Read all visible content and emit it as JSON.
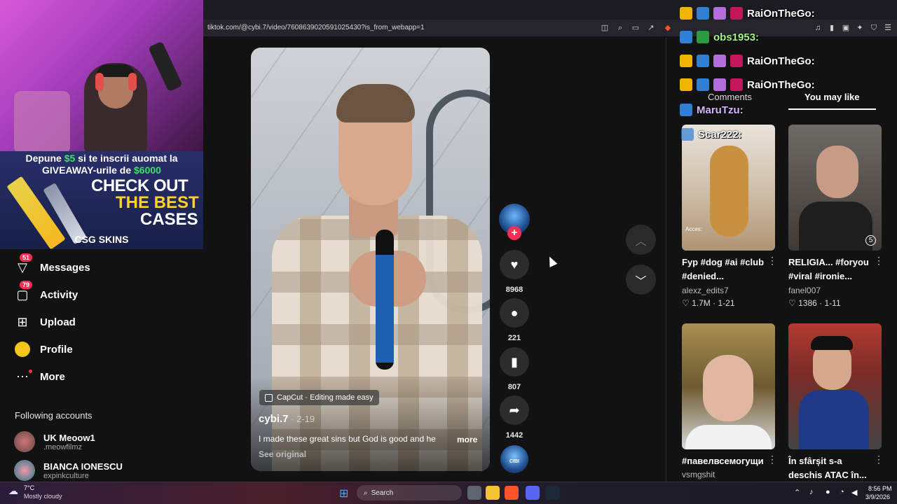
{
  "browser": {
    "url": "tiktok.com/@cybi.7/video/7608639020591025430?is_from_webapp=1"
  },
  "stream_overlay": {
    "promo_line_1_a": "Depune ",
    "promo_line_1_b": "$5",
    "promo_line_1_c": " si te inscrii auomat la",
    "promo_line_2_a": "GIVEAWAY-urile de ",
    "promo_line_2_b": "$6000",
    "check_out": "CHECK OUT",
    "the_best": "THE BEST",
    "cases": "CASES",
    "logo": "CSG SKINS"
  },
  "chat": [
    {
      "name": "RaiOnTheGo:",
      "style": "white"
    },
    {
      "name": "obs1953:",
      "style": "green"
    },
    {
      "name": "RaiOnTheGo:",
      "style": "white"
    },
    {
      "name": "RaiOnTheGo:",
      "style": "white"
    },
    {
      "name": "MaruTzu:",
      "style": "purple"
    },
    {
      "name": "Scar222:",
      "style": "white"
    }
  ],
  "sidebar": {
    "items": [
      {
        "label": "Messages",
        "badge": "51",
        "icon": "send-icon"
      },
      {
        "label": "Activity",
        "badge": "79",
        "icon": "inbox-icon"
      },
      {
        "label": "Upload",
        "icon": "upload-icon"
      },
      {
        "label": "Profile",
        "icon": "profile-icon"
      },
      {
        "label": "More",
        "icon": "more-icon"
      }
    ],
    "following_title": "Following accounts",
    "accounts": [
      {
        "name": "UK Meoow1",
        "handle": ".meowfilmz"
      },
      {
        "name": "BIANCA IONESCU",
        "handle": "expinkculture"
      }
    ]
  },
  "video": {
    "capcut": "CapCut · Editing made easy",
    "author": "cybi.7",
    "date": " · 2-19",
    "caption": "I made these great sins but God is good and he",
    "more": "more",
    "see_original": "See original"
  },
  "actions": {
    "likes": "8968",
    "comments": "221",
    "saves": "807",
    "shares": "1442",
    "music_label": "CIBI"
  },
  "right_panel": {
    "tab_comments": "Comments",
    "tab_you_may_like": "You may like",
    "cards": [
      {
        "title": "Fyp #dog #ai #club #denied...",
        "author": "alexz_edits7",
        "likes": "1.7M",
        "date": "1-21",
        "overlay": "Acces:"
      },
      {
        "title": "RELIGIA... #foryou #viral #ironie...",
        "author": "fanel007",
        "likes": "1386",
        "date": "1-11",
        "overlay": "5"
      },
      {
        "title": "#павелвсемогущи",
        "author": "vsmgshit",
        "likes": "",
        "date": ""
      },
      {
        "title": "În sfârșit s-a deschis ATAC în...",
        "author": "",
        "likes": "",
        "date": ""
      }
    ]
  },
  "taskbar": {
    "temp": "7°C",
    "weather": "Mostly cloudy",
    "search": "Search",
    "time": "8:56 PM",
    "date": "3/9/2026"
  },
  "colors": {
    "accent": "#fe2c55",
    "background": "#121212"
  }
}
